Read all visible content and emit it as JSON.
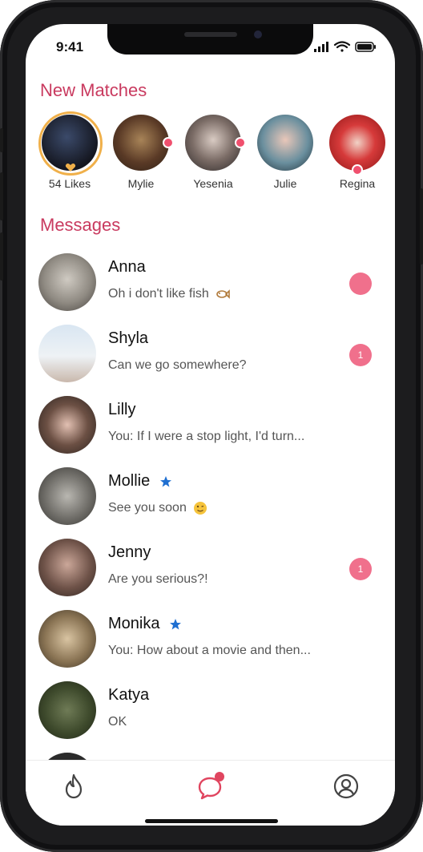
{
  "status_bar": {
    "time": "9:41"
  },
  "new_matches": {
    "title": "New Matches",
    "items": [
      {
        "label": "54 Likes",
        "kind": "likes"
      },
      {
        "label": "Mylie",
        "new": true
      },
      {
        "label": "Yesenia",
        "new": true
      },
      {
        "label": "Julie",
        "new": false
      },
      {
        "label": "Regina",
        "new": true
      }
    ]
  },
  "messages": {
    "title": "Messages",
    "items": [
      {
        "name": "Anna",
        "preview": "Oh i don't like fish",
        "emoji": "fish-emoji",
        "badge": "",
        "starred": false
      },
      {
        "name": "Shyla",
        "preview": "Can we go somewhere?",
        "emoji": "",
        "badge": "1",
        "starred": false
      },
      {
        "name": "Lilly",
        "preview": "You: If I were a stop light, I'd turn...",
        "emoji": "",
        "badge": "",
        "starred": false
      },
      {
        "name": "Mollie",
        "preview": "See you soon",
        "emoji": "winking-face-emoji",
        "badge": "",
        "starred": true
      },
      {
        "name": "Jenny",
        "preview": "Are you serious?!",
        "emoji": "",
        "badge": "1",
        "starred": false
      },
      {
        "name": "Monika",
        "preview": "You: How about a movie and then...",
        "emoji": "",
        "badge": "",
        "starred": true
      },
      {
        "name": "Katya",
        "preview": "OK",
        "emoji": "",
        "badge": "",
        "starred": false
      }
    ]
  },
  "tabs": [
    {
      "icon": "flame-icon"
    },
    {
      "icon": "chat-icon",
      "active": true,
      "notification": true
    },
    {
      "icon": "profile-icon"
    }
  ],
  "colors": {
    "accent": "#c93a5f",
    "badge": "#f0708c",
    "star": "#1f6fd1",
    "likes_ring": "#f0b04a"
  }
}
